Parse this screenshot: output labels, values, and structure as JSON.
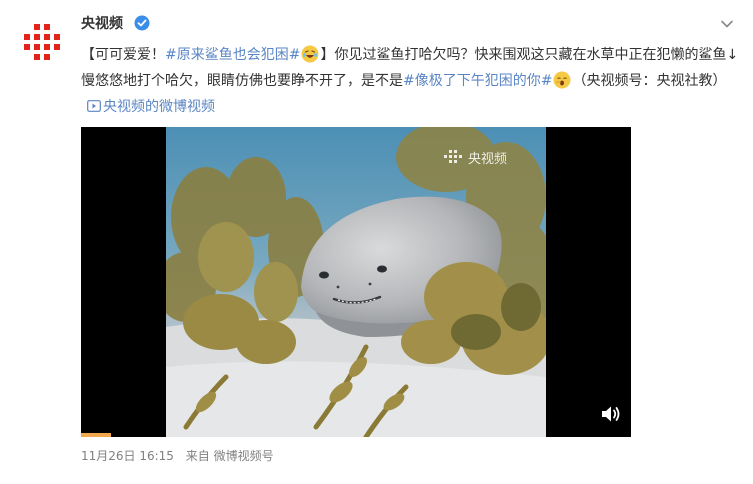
{
  "post": {
    "author": "央视频",
    "verified_icon": "verified-badge-icon",
    "menu_icon": "chevron-down-icon",
    "text_part1": "【可可爱爱！",
    "topic1": "#原来鲨鱼也会犯困#",
    "text_part2": "】你见过鲨鱼打哈欠吗？快来围观这只藏在水草中正在犯懒的鲨鱼↓慢悠悠地打个哈欠，眼睛仿佛也要睁不开了，是不是",
    "topic2": "#像极了下午犯困的你#",
    "text_part3": "（央视频号：央视社教）",
    "video_link": "央视频的微博视频",
    "timestamp": "11月26日 16:15",
    "source": "来自 微博视频号"
  },
  "video": {
    "watermark": "央视频",
    "volume_icon": "volume-icon",
    "progress_percent": 5
  },
  "colors": {
    "topic": "#5a86c4",
    "text": "#333333",
    "meta": "#808080",
    "logo_red": "#e2231a"
  }
}
